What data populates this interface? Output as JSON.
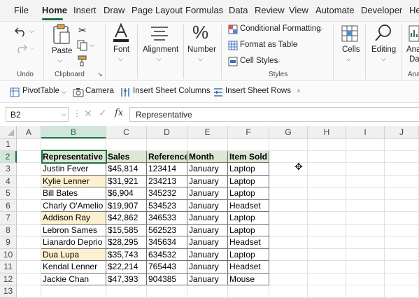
{
  "menu": {
    "items": [
      "File",
      "Home",
      "Insert",
      "Draw",
      "Page Layout",
      "Formulas",
      "Data",
      "Review",
      "View",
      "Automate",
      "Developer",
      "Help"
    ],
    "active": "Home"
  },
  "ribbon": {
    "undo_group": "Undo",
    "clipboard": {
      "paste": "Paste",
      "group": "Clipboard"
    },
    "font": {
      "label": "Font"
    },
    "alignment": {
      "label": "Alignment"
    },
    "number": {
      "label": "Number",
      "symbol": "%"
    },
    "styles": {
      "conditional_formatting": "Conditional Formatting",
      "format_as_table": "Format as Table",
      "cell_styles": "Cell Styles",
      "group": "Styles"
    },
    "cells": {
      "label": "Cells"
    },
    "editing": {
      "label": "Editing"
    },
    "analyze": {
      "label_line1": "Ana",
      "label_line2": "Da",
      "group": "Ana"
    }
  },
  "qat": {
    "pivot_table": "PivotTable",
    "camera": "Camera",
    "insert_sheet_columns": "Insert Sheet Columns",
    "insert_sheet_rows": "Insert Sheet Rows"
  },
  "formula_bar": {
    "name_box": "B2",
    "fx": "fx",
    "value": "Representative"
  },
  "grid": {
    "columns": [
      "A",
      "B",
      "C",
      "D",
      "E",
      "F",
      "G",
      "H",
      "I",
      "J"
    ],
    "rows": [
      "1",
      "2",
      "3",
      "4",
      "5",
      "6",
      "7",
      "8",
      "9",
      "10",
      "11",
      "12",
      "13"
    ],
    "selected_cell": "B2",
    "headers": [
      "Representative",
      "Sales",
      "Reference",
      "Month",
      "Item Sold"
    ],
    "data": [
      [
        "Justin Fever",
        "$45,814",
        "123414",
        "January",
        "Laptop"
      ],
      [
        "Kylie Lenner",
        "$31,921",
        "234213",
        "January",
        "Laptop"
      ],
      [
        "Bill Bates",
        "$6,904",
        "345232",
        "January",
        "Laptop"
      ],
      [
        "Charly O'Amelio",
        "$19,907",
        "534523",
        "January",
        "Headset"
      ],
      [
        "Addison Ray",
        "$42,862",
        "346533",
        "January",
        "Laptop"
      ],
      [
        "Lebron Sames",
        "$15,585",
        "562523",
        "January",
        "Laptop"
      ],
      [
        "Lianardo Deprio",
        "$28,295",
        "345634",
        "January",
        "Headset"
      ],
      [
        "Dua Lupa",
        "$35,743",
        "634532",
        "January",
        "Laptop"
      ],
      [
        "Kendal Lenner",
        "$22,214",
        "765443",
        "January",
        "Headset"
      ],
      [
        "Jackie Chan",
        "$47,393",
        "904385",
        "January",
        "Mouse"
      ]
    ],
    "highlighted_rows": [
      1,
      4,
      7
    ],
    "colors": {
      "header_fill": "#dce8d3",
      "highlight_fill": "#fdf0d0",
      "selection": "#1e7145"
    }
  }
}
